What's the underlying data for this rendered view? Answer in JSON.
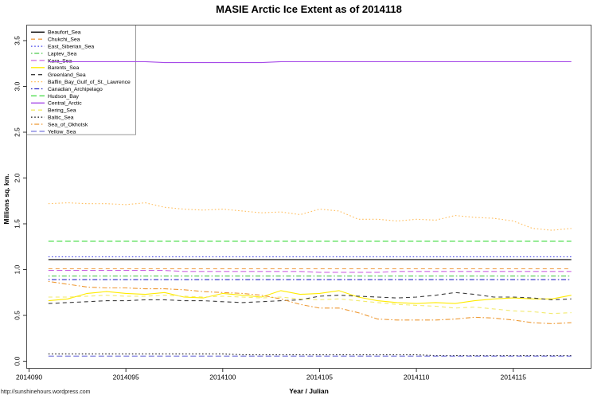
{
  "page": {
    "watermark": "http://sunshinehours.wordpress.com"
  },
  "chart_data": {
    "type": "line",
    "title": "MASIE Arctic Ice Extent as of 2014118",
    "xlabel": "Year / Julian",
    "ylabel": "Millions sq. km.",
    "xlim": [
      2014090,
      2014119
    ],
    "ylim": [
      0.0,
      3.5
    ],
    "grid": false,
    "legend_position": "topleft",
    "x_ticks": [
      "2014090",
      "2014095",
      "2014100",
      "2014105",
      "2014110",
      "2014115"
    ],
    "x_tick_values": [
      2014090,
      2014095,
      2014100,
      2014105,
      2014110,
      2014115
    ],
    "y_ticks": [
      "0.0",
      "0.5",
      "1.0",
      "1.5",
      "2.0",
      "2.5",
      "3.0",
      "3.5"
    ],
    "y_tick_values": [
      0.0,
      0.5,
      1.0,
      1.5,
      2.0,
      2.5,
      3.0,
      3.5
    ],
    "x": [
      2014091,
      2014092,
      2014093,
      2014094,
      2014095,
      2014096,
      2014097,
      2014098,
      2014099,
      2014100,
      2014101,
      2014102,
      2014103,
      2014104,
      2014105,
      2014106,
      2014107,
      2014108,
      2014109,
      2014110,
      2014111,
      2014112,
      2014113,
      2014114,
      2014115,
      2014116,
      2014117,
      2014118
    ],
    "series": [
      {
        "name": "Beaufort_Sea",
        "color": "#000000",
        "linestyle": "solid",
        "values": [
          1.11,
          1.11,
          1.11,
          1.11,
          1.11,
          1.11,
          1.11,
          1.11,
          1.11,
          1.11,
          1.11,
          1.11,
          1.11,
          1.11,
          1.11,
          1.11,
          1.11,
          1.11,
          1.11,
          1.11,
          1.11,
          1.11,
          1.11,
          1.11,
          1.11,
          1.11,
          1.11,
          1.11
        ]
      },
      {
        "name": "Chukchi_Sea",
        "color": "#F0A04B",
        "linestyle": "dashed",
        "values": [
          1.01,
          1.01,
          1.01,
          1.01,
          1.01,
          1.01,
          1.01,
          1.01,
          1.01,
          1.01,
          1.01,
          1.01,
          1.01,
          1.01,
          1.01,
          1.01,
          1.01,
          1.01,
          1.01,
          1.01,
          1.01,
          1.01,
          1.01,
          1.01,
          1.01,
          1.01,
          1.01,
          1.01
        ]
      },
      {
        "name": "East_Siberian_Sea",
        "color": "#4646E8",
        "linestyle": "dotted",
        "values": [
          1.14,
          1.14,
          1.14,
          1.14,
          1.14,
          1.14,
          1.14,
          1.14,
          1.14,
          1.14,
          1.14,
          1.14,
          1.14,
          1.14,
          1.14,
          1.14,
          1.14,
          1.14,
          1.14,
          1.14,
          1.14,
          1.14,
          1.14,
          1.14,
          1.14,
          1.14,
          1.14,
          1.14
        ]
      },
      {
        "name": "Laptev_Sea",
        "color": "#4DC94D",
        "linestyle": "dashdot",
        "values": [
          0.93,
          0.93,
          0.93,
          0.93,
          0.93,
          0.93,
          0.93,
          0.93,
          0.93,
          0.93,
          0.93,
          0.93,
          0.93,
          0.93,
          0.93,
          0.93,
          0.93,
          0.93,
          0.93,
          0.93,
          0.93,
          0.93,
          0.93,
          0.93,
          0.93,
          0.93,
          0.93,
          0.93
        ]
      },
      {
        "name": "Kara_Sea",
        "color": "#CC66E0",
        "linestyle": "longdash",
        "values": [
          0.99,
          0.99,
          0.99,
          0.99,
          0.99,
          0.99,
          0.99,
          0.98,
          0.98,
          0.98,
          0.98,
          0.98,
          0.98,
          0.98,
          0.97,
          0.97,
          0.97,
          0.97,
          0.98,
          0.98,
          0.98,
          0.98,
          0.98,
          0.98,
          0.98,
          0.98,
          0.98,
          0.98
        ]
      },
      {
        "name": "Barents_Sea",
        "color": "#FFEB00",
        "linestyle": "solid",
        "values": [
          0.66,
          0.68,
          0.74,
          0.76,
          0.74,
          0.73,
          0.75,
          0.7,
          0.69,
          0.74,
          0.72,
          0.7,
          0.77,
          0.73,
          0.74,
          0.77,
          0.7,
          0.66,
          0.64,
          0.63,
          0.64,
          0.63,
          0.66,
          0.68,
          0.69,
          0.68,
          0.68,
          0.72
        ]
      },
      {
        "name": "Greenland_Sea",
        "color": "#3D3D3D",
        "linestyle": "dashed",
        "values": [
          0.63,
          0.64,
          0.65,
          0.66,
          0.66,
          0.67,
          0.67,
          0.66,
          0.66,
          0.65,
          0.64,
          0.65,
          0.66,
          0.67,
          0.71,
          0.72,
          0.71,
          0.7,
          0.69,
          0.7,
          0.72,
          0.75,
          0.73,
          0.7,
          0.7,
          0.69,
          0.67,
          0.68
        ]
      },
      {
        "name": "Baffin_Bay_Gulf_of_St._Lawrence",
        "color": "#FFBE5E",
        "linestyle": "dotted",
        "values": [
          1.72,
          1.73,
          1.72,
          1.72,
          1.71,
          1.73,
          1.68,
          1.66,
          1.65,
          1.66,
          1.64,
          1.62,
          1.63,
          1.6,
          1.66,
          1.64,
          1.55,
          1.55,
          1.53,
          1.55,
          1.54,
          1.59,
          1.57,
          1.56,
          1.53,
          1.45,
          1.43,
          1.45
        ]
      },
      {
        "name": "Canadian_Archipelago",
        "color": "#2A2AC8",
        "linestyle": "dashdot",
        "values": [
          0.89,
          0.89,
          0.89,
          0.89,
          0.89,
          0.89,
          0.89,
          0.89,
          0.89,
          0.89,
          0.89,
          0.89,
          0.89,
          0.89,
          0.89,
          0.89,
          0.89,
          0.89,
          0.89,
          0.89,
          0.89,
          0.89,
          0.89,
          0.89,
          0.89,
          0.89,
          0.89,
          0.89
        ]
      },
      {
        "name": "Hudson_Bay",
        "color": "#3FDB3F",
        "linestyle": "longdash",
        "values": [
          1.31,
          1.31,
          1.31,
          1.31,
          1.31,
          1.31,
          1.31,
          1.31,
          1.31,
          1.31,
          1.31,
          1.31,
          1.31,
          1.31,
          1.31,
          1.31,
          1.31,
          1.31,
          1.31,
          1.31,
          1.31,
          1.31,
          1.31,
          1.31,
          1.31,
          1.31,
          1.31,
          1.31
        ]
      },
      {
        "name": "Central_Arctic",
        "color": "#A64AE8",
        "linestyle": "solid",
        "values": [
          3.27,
          3.27,
          3.27,
          3.27,
          3.27,
          3.27,
          3.26,
          3.26,
          3.26,
          3.26,
          3.26,
          3.26,
          3.27,
          3.27,
          3.27,
          3.27,
          3.27,
          3.27,
          3.27,
          3.27,
          3.27,
          3.27,
          3.27,
          3.27,
          3.27,
          3.27,
          3.27,
          3.27
        ]
      },
      {
        "name": "Bering_Sea",
        "color": "#F2EA6E",
        "linestyle": "dashed",
        "values": [
          0.7,
          0.7,
          0.71,
          0.72,
          0.71,
          0.71,
          0.72,
          0.71,
          0.7,
          0.71,
          0.7,
          0.69,
          0.7,
          0.68,
          0.67,
          0.68,
          0.66,
          0.64,
          0.62,
          0.61,
          0.6,
          0.58,
          0.59,
          0.57,
          0.55,
          0.54,
          0.52,
          0.53
        ]
      },
      {
        "name": "Baltic_Sea",
        "color": "#141414",
        "linestyle": "dotted",
        "values": [
          0.08,
          0.08,
          0.08,
          0.08,
          0.08,
          0.08,
          0.08,
          0.08,
          0.08,
          0.08,
          0.07,
          0.07,
          0.07,
          0.07,
          0.07,
          0.07,
          0.07,
          0.07,
          0.07,
          0.07,
          0.06,
          0.06,
          0.06,
          0.06,
          0.06,
          0.06,
          0.06,
          0.06
        ]
      },
      {
        "name": "Sea_of_Okhotsk",
        "color": "#EE9933",
        "linestyle": "dashdot",
        "values": [
          0.87,
          0.84,
          0.81,
          0.8,
          0.8,
          0.79,
          0.79,
          0.78,
          0.76,
          0.75,
          0.74,
          0.72,
          0.68,
          0.62,
          0.58,
          0.58,
          0.53,
          0.46,
          0.45,
          0.45,
          0.45,
          0.46,
          0.48,
          0.47,
          0.45,
          0.42,
          0.41,
          0.42
        ]
      },
      {
        "name": "Yellow_Sea",
        "color": "#7373DC",
        "linestyle": "longdash",
        "values": [
          0.055,
          0.055,
          0.055,
          0.055,
          0.055,
          0.055,
          0.055,
          0.055,
          0.055,
          0.055,
          0.055,
          0.055,
          0.055,
          0.055,
          0.055,
          0.055,
          0.055,
          0.055,
          0.055,
          0.055,
          0.055,
          0.055,
          0.055,
          0.055,
          0.055,
          0.055,
          0.055,
          0.055
        ]
      }
    ]
  }
}
